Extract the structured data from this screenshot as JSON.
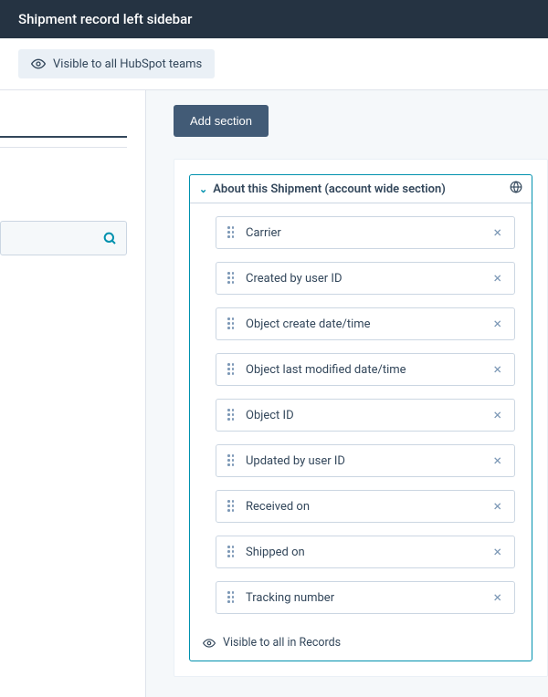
{
  "header": {
    "title": "Shipment record left sidebar"
  },
  "visibility": {
    "label": "Visible to all HubSpot teams"
  },
  "actions": {
    "add_section": "Add section"
  },
  "section": {
    "title": "About this Shipment (account wide section)",
    "footer": "Visible to all in Records",
    "properties": [
      {
        "label": "Carrier"
      },
      {
        "label": "Created by user ID"
      },
      {
        "label": "Object create date/time"
      },
      {
        "label": "Object last modified date/time"
      },
      {
        "label": "Object ID"
      },
      {
        "label": "Updated by user ID"
      },
      {
        "label": "Received on"
      },
      {
        "label": "Shipped on"
      },
      {
        "label": "Tracking number"
      }
    ]
  }
}
